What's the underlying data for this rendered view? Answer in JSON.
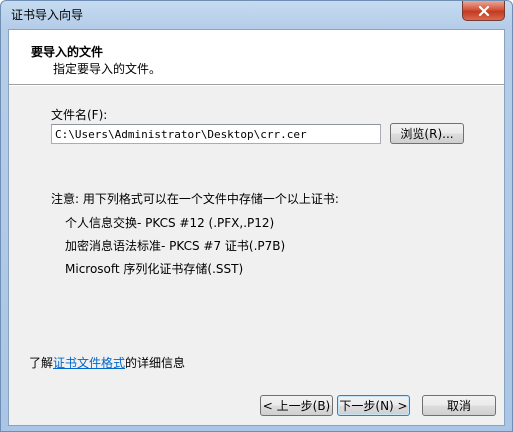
{
  "window": {
    "title": "证书导入向导"
  },
  "header": {
    "title": "要导入的文件",
    "subtitle": "指定要导入的文件。"
  },
  "file": {
    "label": "文件名(F):",
    "value": "C:\\Users\\Administrator\\Desktop\\crr.cer",
    "browse_label": "浏览(R)..."
  },
  "note": {
    "intro": "注意: 用下列格式可以在一个文件中存储一个以上证书:",
    "formats": [
      "个人信息交换- PKCS #12 (.PFX,.P12)",
      "加密消息语法标准- PKCS #7 证书(.P7B)",
      "Microsoft 序列化证书存储(.SST)"
    ]
  },
  "more_info": {
    "prefix": "了解",
    "link": "证书文件格式",
    "suffix": "的详细信息"
  },
  "footer": {
    "back_label": "< 上一步(B)",
    "next_label": "下一步(N) >",
    "cancel_label": "取消"
  }
}
